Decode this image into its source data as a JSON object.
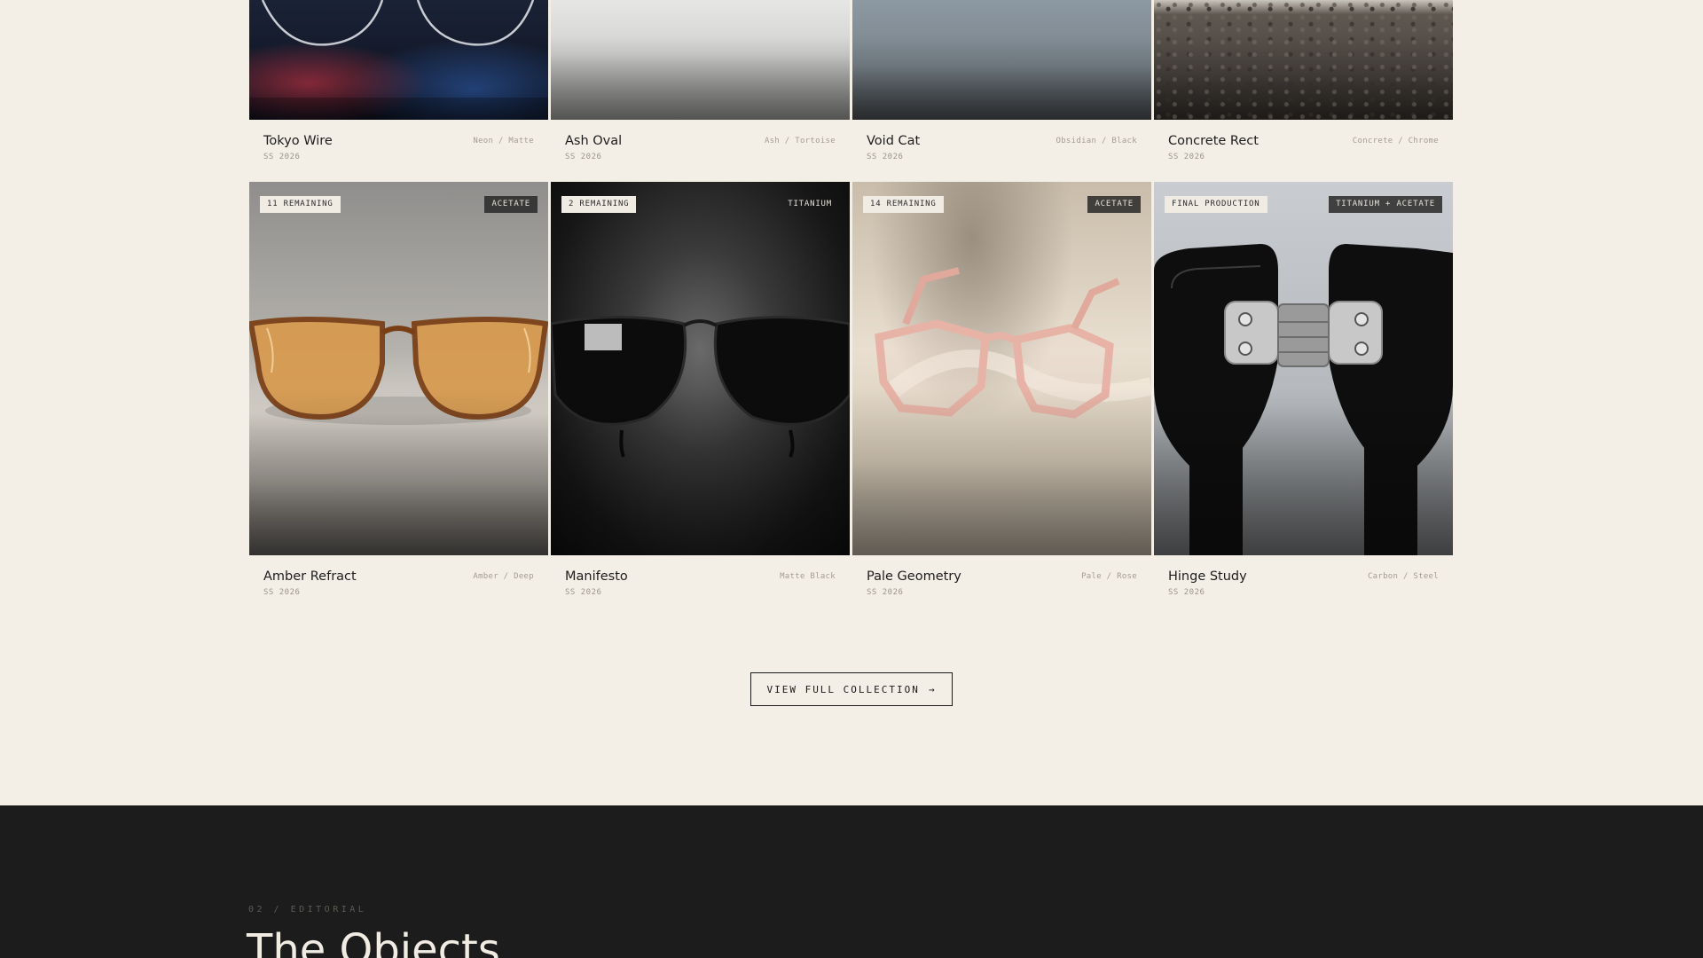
{
  "top_row": [
    {
      "name": "Tokyo Wire",
      "material": "Neon / Matte",
      "season": "SS 2026"
    },
    {
      "name": "Ash Oval",
      "material": "Ash / Tortoise",
      "season": "SS 2026"
    },
    {
      "name": "Void Cat",
      "material": "Obsidian / Black",
      "season": "SS 2026"
    },
    {
      "name": "Concrete Rect",
      "material": "Concrete / Chrome",
      "season": "SS 2026"
    }
  ],
  "bottom_row": [
    {
      "name": "Amber Refract",
      "material": "Amber / Deep",
      "season": "SS 2026",
      "stock_tag": "11 REMAINING",
      "type_tag": "ACETATE"
    },
    {
      "name": "Manifesto",
      "material": "Matte Black",
      "season": "SS 2026",
      "stock_tag": "2 REMAINING",
      "type_tag": "TITANIUM"
    },
    {
      "name": "Pale Geometry",
      "material": "Pale / Rose",
      "season": "SS 2026",
      "stock_tag": "14 REMAINING",
      "type_tag": "ACETATE"
    },
    {
      "name": "Hinge Study",
      "material": "Carbon / Steel",
      "season": "SS 2026",
      "stock_tag": "FINAL PRODUCTION",
      "type_tag": "TITANIUM + ACETATE"
    }
  ],
  "cta": {
    "label": "VIEW FULL COLLECTION",
    "arrow": "→"
  },
  "editorial": {
    "eyebrow": "02 / EDITORIAL",
    "title": "The Objects"
  },
  "colors": {
    "background": "#f4efe6",
    "dark_section": "#1c1c1c",
    "text": "#1a1a1a"
  }
}
